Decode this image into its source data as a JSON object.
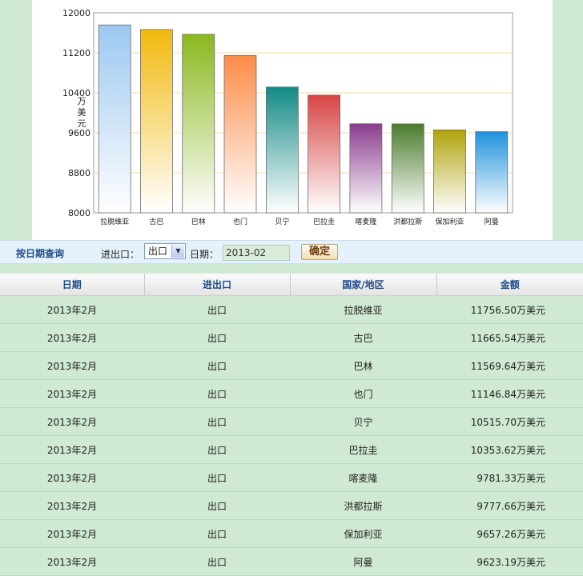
{
  "chart_data": {
    "type": "bar",
    "ylabel": "万美元",
    "ylim": [
      8000,
      12000
    ],
    "yticks": [
      "12000",
      "11200",
      "10400",
      "9600",
      "8800",
      "8000"
    ],
    "categories": [
      "拉脱维亚",
      "古巴",
      "巴林",
      "也门",
      "贝宁",
      "巴拉圭",
      "喀麦隆",
      "洪都拉斯",
      "保加利亚",
      "阿曼"
    ],
    "values": [
      11756.5,
      11665.54,
      11569.64,
      11146.84,
      10515.7,
      10353.62,
      9781.33,
      9777.66,
      9657.26,
      9623.19
    ],
    "colors": [
      "#9cc8f0",
      "#f2b90d",
      "#8ab81e",
      "#ff8c48",
      "#128a86",
      "#d74444",
      "#8a3c8e",
      "#4a7c2c",
      "#b0a30c",
      "#1f92dc"
    ],
    "grid": true
  },
  "query": {
    "title": "按日期查询",
    "inout_label": "进出口：",
    "inout_value": "出口",
    "date_label": "日期：",
    "date_value": "2013-02",
    "confirm_label": "确定"
  },
  "table": {
    "headers": [
      "日期",
      "进出口",
      "国家/地区",
      "金额"
    ],
    "rows": [
      [
        "2013年2月",
        "出口",
        "拉脱维亚",
        "11756.50万美元"
      ],
      [
        "2013年2月",
        "出口",
        "古巴",
        "11665.54万美元"
      ],
      [
        "2013年2月",
        "出口",
        "巴林",
        "11569.64万美元"
      ],
      [
        "2013年2月",
        "出口",
        "也门",
        "11146.84万美元"
      ],
      [
        "2013年2月",
        "出口",
        "贝宁",
        "10515.70万美元"
      ],
      [
        "2013年2月",
        "出口",
        "巴拉圭",
        "10353.62万美元"
      ],
      [
        "2013年2月",
        "出口",
        "喀麦隆",
        "9781.33万美元"
      ],
      [
        "2013年2月",
        "出口",
        "洪都拉斯",
        "9777.66万美元"
      ],
      [
        "2013年2月",
        "出口",
        "保加利亚",
        "9657.26万美元"
      ],
      [
        "2013年2月",
        "出口",
        "阿曼",
        "9623.19万美元"
      ]
    ]
  }
}
